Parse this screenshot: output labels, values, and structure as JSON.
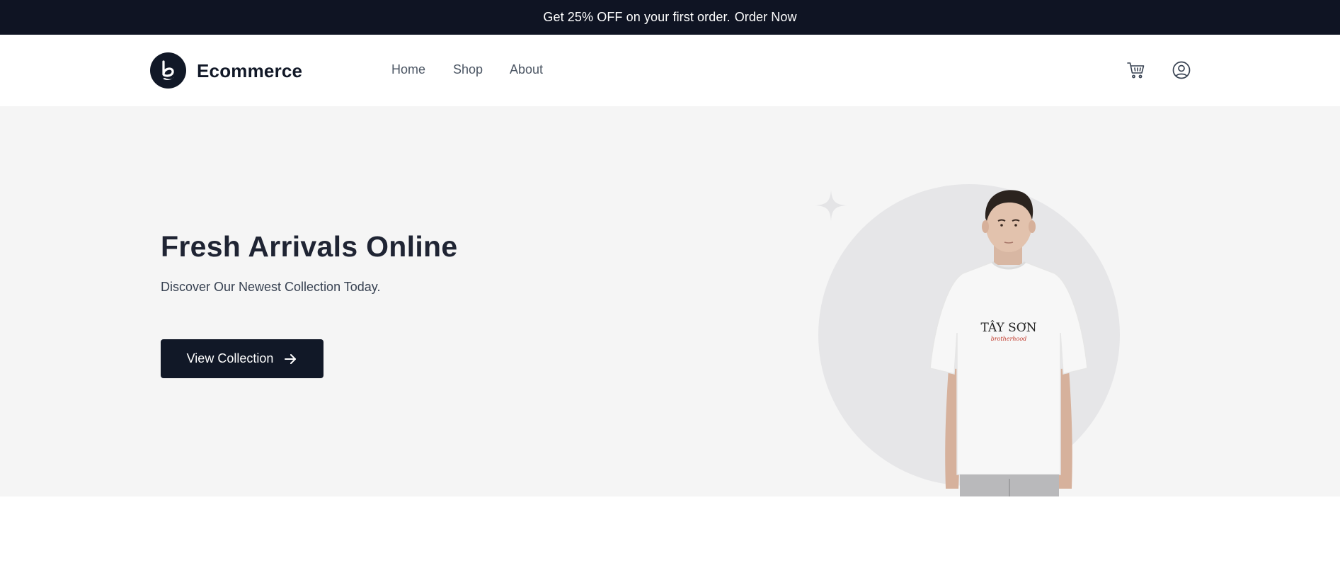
{
  "announcement": {
    "text": "Get 25% OFF on your first order.",
    "cta": "Order Now"
  },
  "header": {
    "brand": "Ecommerce",
    "logo_icon": "ecommerce-logo-icon",
    "nav": [
      "Home",
      "Shop",
      "About"
    ],
    "icons": [
      "cart-icon",
      "user-icon"
    ]
  },
  "hero": {
    "title": "Fresh Arrivals Online",
    "subtitle": "Discover Our Newest Collection Today.",
    "button_label": "View Collection",
    "button_icon": "arrow-right-icon",
    "image": {
      "shirt_text": "TÂY SƠN",
      "shirt_script": "brotherhood"
    }
  },
  "colors": {
    "dark": "#0f1423",
    "hero_bg": "#f5f5f5",
    "circle": "#e6e6e8",
    "nav_text": "#4b5563"
  }
}
